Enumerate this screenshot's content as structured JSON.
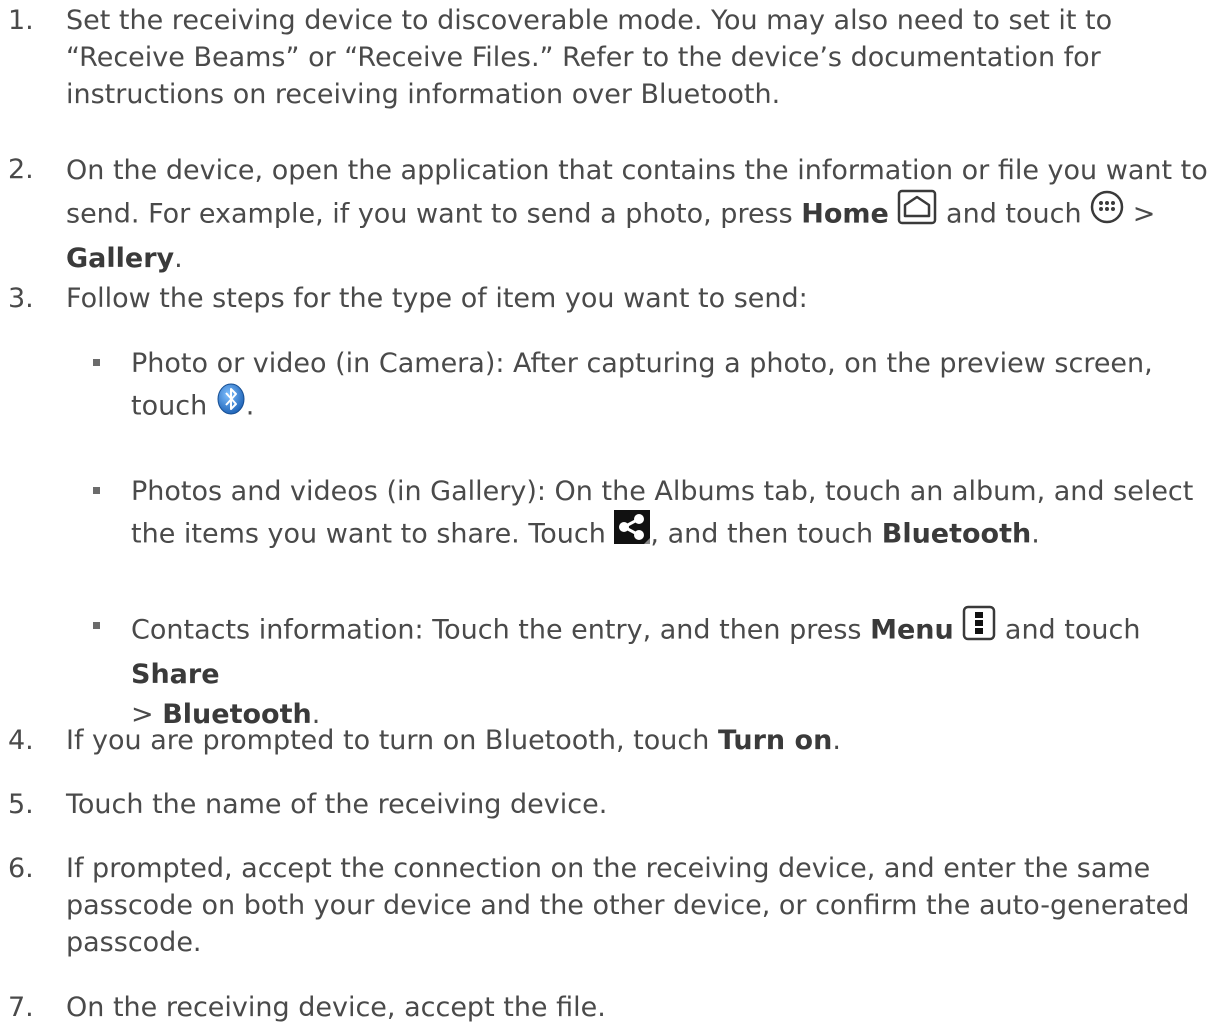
{
  "steps": [
    {
      "num": "1.",
      "text": "Set the receiving device to discoverable mode. You may also need to set it to “Receive Beams” or “Receive Files.” Refer to the device’s documentation for instructions on receiving information over Bluetooth."
    },
    {
      "num": "2.",
      "pre": "On the device, open the application that contains the information or file you want to send. For example, if you want to send a photo, press ",
      "bold1": "Home",
      "mid": " and touch ",
      "sep": " > ",
      "bold2": "Gallery",
      "end": "."
    },
    {
      "num": "3.",
      "text": "Follow the steps for the type of item you want to send:"
    },
    {
      "num": "4.",
      "pre": "If you are prompted to turn on Bluetooth, touch ",
      "bold": "Turn on",
      "end": "."
    },
    {
      "num": "5.",
      "text": "Touch the name of the receiving device."
    },
    {
      "num": "6.",
      "text": "If prompted, accept the connection on the receiving device, and enter the same passcode on both your device and the other device, or confirm the auto-generated passcode."
    },
    {
      "num": "7.",
      "text": "On the receiving device, accept the file."
    }
  ],
  "substeps": [
    {
      "pre": "Photo or video (in Camera): After capturing a photo, on the preview screen, touch ",
      "end": ".",
      "icon": "bluetooth-icon"
    },
    {
      "pre": "Photos and videos (in Gallery): On the Albums tab, touch an album, and select the items you want to share. Touch ",
      "mid": ", and then touch ",
      "bold": "Bluetooth",
      "end": ".",
      "icon": "share-icon"
    },
    {
      "pre": "Contacts information: Touch the entry, and then press ",
      "bold1": "Menu",
      "mid": " and touch ",
      "bold2": "Share",
      "sep": "> ",
      "bold3": "Bluetooth",
      "end": ".",
      "icon": "menu-key-icon"
    }
  ],
  "icons": {
    "home": "home-key-icon",
    "apps": "all-apps-icon"
  },
  "colors": {
    "text": "#4a4a4a",
    "bullet": "#6b6b6b",
    "bluetooth": "#2f7fd8"
  }
}
